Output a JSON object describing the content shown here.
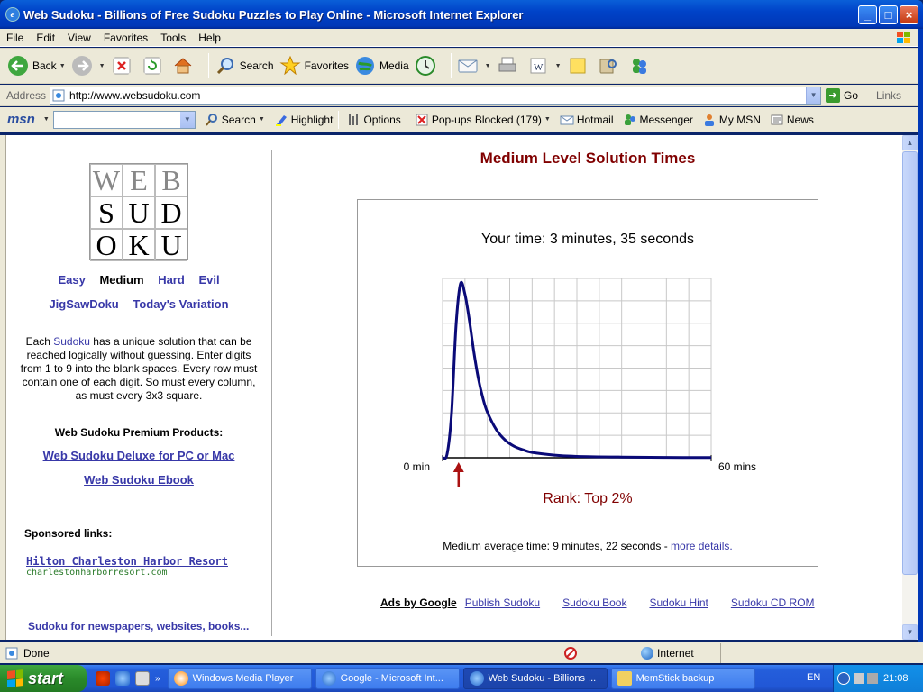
{
  "window": {
    "title": "Web Sudoku - Billions of Free Sudoku Puzzles to Play Online - Microsoft Internet Explorer"
  },
  "menu": [
    "File",
    "Edit",
    "View",
    "Favorites",
    "Tools",
    "Help"
  ],
  "toolbar": {
    "back": "Back",
    "search": "Search",
    "favorites": "Favorites",
    "media": "Media"
  },
  "address": {
    "label": "Address",
    "url": "http://www.websudoku.com",
    "go": "Go",
    "links": "Links"
  },
  "msn": {
    "logo": "msn",
    "search": "Search",
    "highlight": "Highlight",
    "options": "Options",
    "popups": "Pop-ups Blocked (179)",
    "hotmail": "Hotmail",
    "messenger": "Messenger",
    "mymsn": "My MSN",
    "news": "News"
  },
  "left": {
    "logo_letters": [
      "W",
      "E",
      "B",
      "S",
      "U",
      "D",
      "O",
      "K",
      "U"
    ],
    "levels": {
      "easy": "Easy",
      "medium": "Medium",
      "hard": "Hard",
      "evil": "Evil"
    },
    "jigsaw": "JigSawDoku",
    "variation": "Today's Variation",
    "desc_pre": "Each ",
    "desc_link": "Sudoku",
    "desc_post": " has a unique solution that can be reached logically without guessing. Enter digits from 1 to 9 into the blank spaces. Every row must contain one of each digit. So must every column, as must every 3x3 square.",
    "premium_title": "Web Sudoku Premium Products:",
    "premium_deluxe": "Web Sudoku Deluxe for PC or Mac",
    "premium_ebook": "Web Sudoku Ebook",
    "sponsored": "Sponsored links:",
    "hilton": "Hilton Charleston Harbor Resort",
    "hilton_url": "charlestonharborresort.com",
    "newspapers": "Sudoku for newspapers, websites, books..."
  },
  "main": {
    "title": "Medium Level Solution Times",
    "your_time": "Your time: 3 minutes, 35 seconds",
    "rank": "Rank: Top 2%",
    "avg_pre": "Medium average time: 9 minutes, 22 seconds  -  ",
    "avg_link": "more details."
  },
  "chart_data": {
    "type": "line",
    "xlabel_min": "0 min",
    "xlabel_max": "60 mins",
    "xlim": [
      0,
      60
    ],
    "ylim": [
      0,
      1
    ],
    "grid": true,
    "marker_x": 3.58,
    "marker_color": "#aa1111",
    "line_color": "#0a0a78",
    "x": [
      0,
      1,
      2,
      3,
      4,
      5,
      6,
      7,
      8,
      9,
      10,
      12,
      14,
      16,
      18,
      20,
      25,
      30,
      40,
      50,
      60
    ],
    "y": [
      0,
      0.02,
      0.25,
      0.75,
      0.99,
      0.93,
      0.78,
      0.6,
      0.45,
      0.34,
      0.26,
      0.16,
      0.1,
      0.065,
      0.045,
      0.03,
      0.015,
      0.008,
      0.004,
      0.002,
      0.001
    ]
  },
  "ads": {
    "by": "Ads by Google",
    "links": [
      "Publish Sudoku",
      "Sudoku Book",
      "Sudoku Hint",
      "Sudoku CD ROM"
    ]
  },
  "status": {
    "text": "Done",
    "zone": "Internet"
  },
  "taskbar": {
    "start": "start",
    "tasks": [
      "Windows Media Player",
      "Google - Microsoft Int...",
      "Web Sudoku - Billions ...",
      "MemStick backup"
    ],
    "lang": "EN",
    "clock": "21:08"
  }
}
